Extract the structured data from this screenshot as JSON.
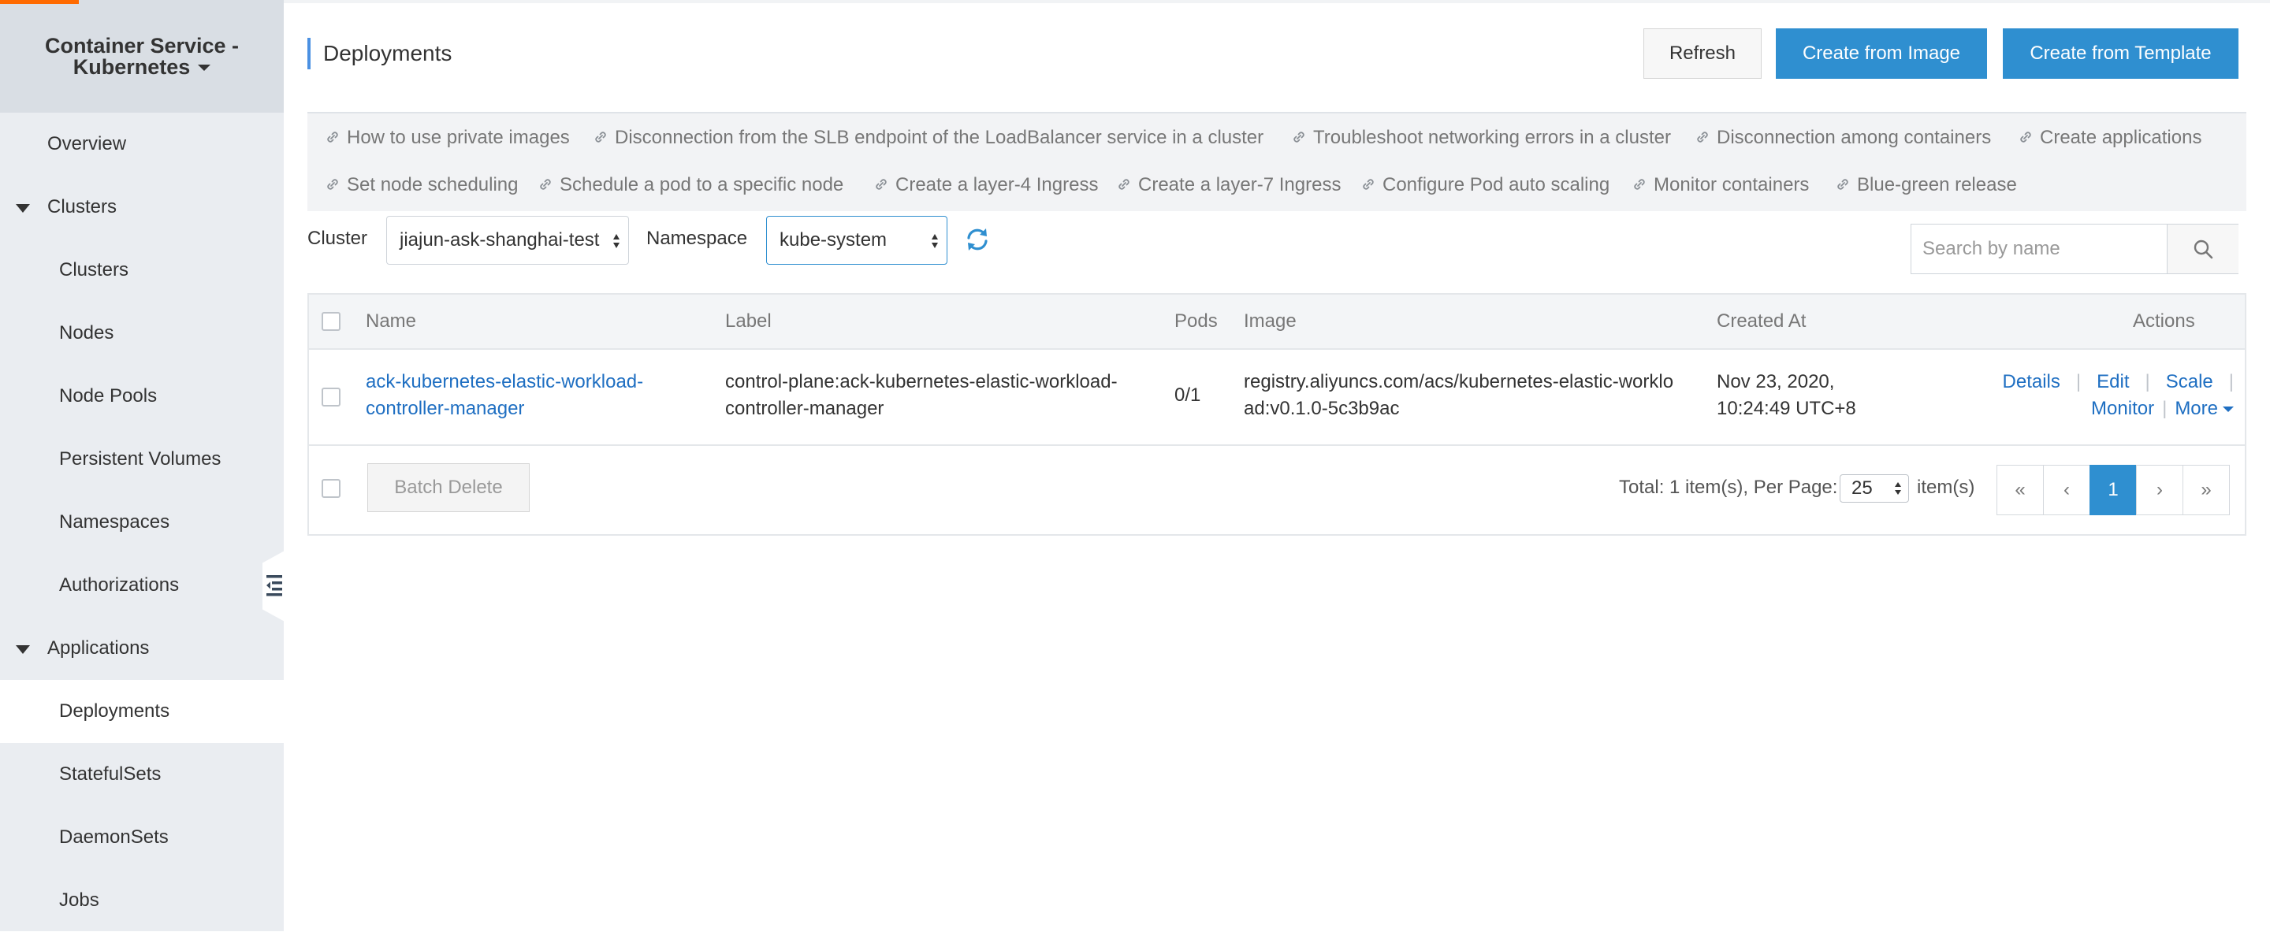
{
  "sidebar": {
    "brand_line1": "Container Service -",
    "brand_line2": "Kubernetes",
    "overview": "Overview",
    "clusters_group": "Clusters",
    "clusters_items": [
      "Clusters",
      "Nodes",
      "Node Pools",
      "Persistent Volumes",
      "Namespaces",
      "Authorizations"
    ],
    "applications_group": "Applications",
    "applications_items": [
      "Deployments",
      "StatefulSets",
      "DaemonSets",
      "Jobs"
    ],
    "active_item": "Deployments"
  },
  "header": {
    "title": "Deployments",
    "refresh_label": "Refresh",
    "create_image_label": "Create from Image",
    "create_template_label": "Create from Template"
  },
  "tips": {
    "row1": [
      "How to use private images",
      "Disconnection from the SLB endpoint of the LoadBalancer service in a cluster",
      "Troubleshoot networking errors in a cluster",
      "Disconnection among containers",
      "Create applications"
    ],
    "row2": [
      "Set node scheduling",
      "Schedule a pod to a specific node",
      "Create a layer-4 Ingress",
      "Create a layer-7 Ingress",
      "Configure Pod auto scaling",
      "Monitor containers",
      "Blue-green release"
    ]
  },
  "filters": {
    "cluster_label": "Cluster",
    "cluster_value": "jiajun-ask-shanghai-test",
    "namespace_label": "Namespace",
    "namespace_value": "kube-system",
    "search_placeholder": "Search by name"
  },
  "table": {
    "columns": [
      "Name",
      "Label",
      "Pods",
      "Image",
      "Created At",
      "Actions"
    ],
    "rows": [
      {
        "name_line1": "ack-kubernetes-elastic-workload-",
        "name_line2": "controller-manager",
        "label_line1": "control-plane:ack-kubernetes-elastic-workload-",
        "label_line2": "controller-manager",
        "pods": "0/1",
        "image_line1": "registry.aliyuncs.com/acs/kubernetes-elastic-worklo",
        "image_line2": "ad:v0.1.0-5c3b9ac",
        "created_line1": "Nov 23, 2020,",
        "created_line2": "10:24:49 UTC+8",
        "actions": {
          "details": "Details",
          "edit": "Edit",
          "scale": "Scale",
          "monitor": "Monitor",
          "more": "More",
          "separator": "|"
        }
      }
    ],
    "footer": {
      "batch_delete": "Batch Delete",
      "total_text": "Total: 1 item(s), Per Page:",
      "per_page": "25",
      "items_suffix": "item(s)",
      "pagination": {
        "first": "«",
        "prev": "‹",
        "current": "1",
        "next": "›",
        "last": "»"
      }
    }
  },
  "colors": {
    "primary": "#2f8fd0",
    "link": "#1f6fc2",
    "accent": "#ff6a00",
    "sidebar_bg": "#eaedf1"
  }
}
